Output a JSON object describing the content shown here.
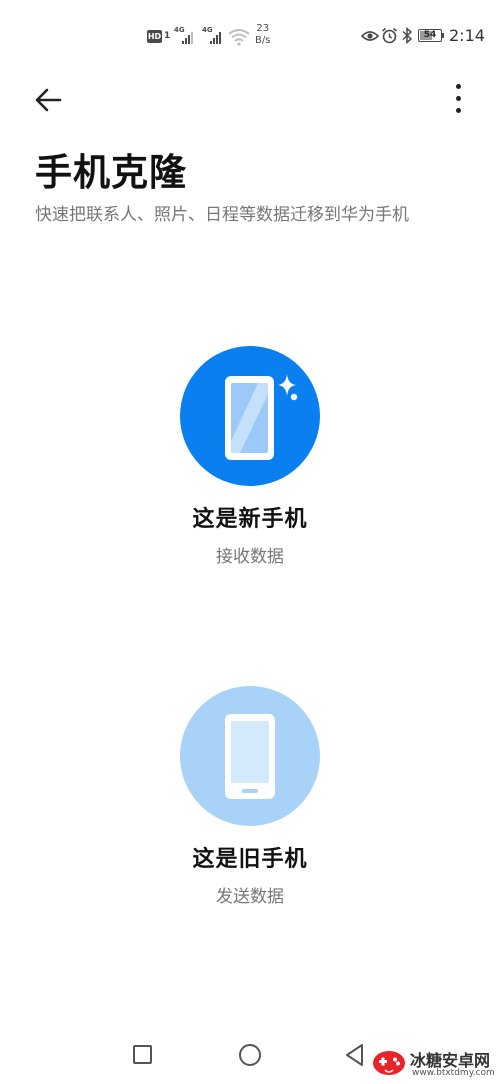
{
  "status_bar": {
    "hd_label": "HD",
    "hd_slot": "1",
    "signal1_label": "4G",
    "signal2_label": "4G",
    "speed_value": "23",
    "speed_unit": "B/s",
    "battery_level": "54",
    "time": "2:14"
  },
  "header": {
    "title": "手机克隆",
    "subtitle": "快速把联系人、照片、日程等数据迁移到华为手机"
  },
  "options": [
    {
      "title": "这是新手机",
      "subtitle": "接收数据",
      "icon": "new-phone-icon"
    },
    {
      "title": "这是旧手机",
      "subtitle": "发送数据",
      "icon": "old-phone-icon"
    }
  ],
  "colors": {
    "accent": "#0a7ff0",
    "accent_light": "#a8d2f8"
  },
  "watermark": {
    "title": "冰糖安卓网",
    "url": "www.btxtdmy.com"
  }
}
